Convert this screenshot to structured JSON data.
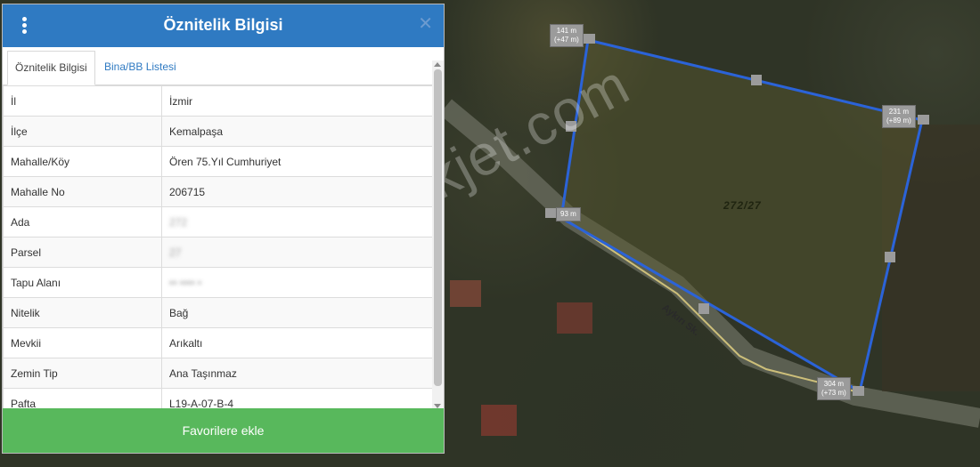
{
  "panel": {
    "title": "Öznitelik Bilgisi",
    "tabs": [
      {
        "label": "Öznitelik Bilgisi",
        "active": true
      },
      {
        "label": "Bina/BB Listesi",
        "active": false
      }
    ],
    "rows": [
      {
        "key": "İl",
        "value": "İzmir"
      },
      {
        "key": "İlçe",
        "value": "Kemalpaşa"
      },
      {
        "key": "Mahalle/Köy",
        "value": "Ören 75.Yıl Cumhuriyet"
      },
      {
        "key": "Mahalle No",
        "value": "206715"
      },
      {
        "key": "Ada",
        "value": "272"
      },
      {
        "key": "Parsel",
        "value": "27"
      },
      {
        "key": "Tapu Alanı",
        "value": "•• •••• •"
      },
      {
        "key": "Nitelik",
        "value": "Bağ"
      },
      {
        "key": "Mevkii",
        "value": "Arıkaltı"
      },
      {
        "key": "Zemin Tip",
        "value": "Ana Taşınmaz"
      },
      {
        "key": "Pafta",
        "value": "L19-A-07-B-4"
      }
    ],
    "favorite_button": "Favorilere ekle"
  },
  "map": {
    "parcel_label": "272/27",
    "street_label": "Aykırı Sk.",
    "watermark": "emlakjet.com",
    "distance_labels": [
      {
        "line1": "141 m",
        "line2": "(+47 m)"
      },
      {
        "line1": "231 m",
        "line2": "(+89 m)"
      },
      {
        "line1": "93 m",
        "line2": ""
      },
      {
        "line1": "304 m",
        "line2": "(+73 m)"
      }
    ],
    "colors": {
      "boundary": "#2b63d8",
      "road": "#cdbf7a",
      "header": "#2f7ac2",
      "button": "#58b85c"
    }
  }
}
